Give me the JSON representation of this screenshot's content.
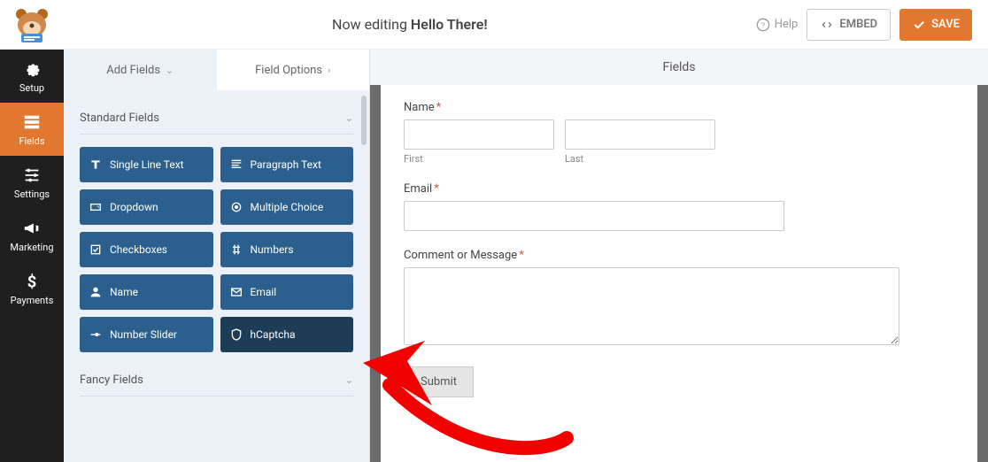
{
  "topbar": {
    "editing_prefix": "Now editing ",
    "title": "Hello There!",
    "help": "Help",
    "embed": "EMBED",
    "save": "SAVE"
  },
  "sidebar": {
    "items": [
      {
        "label": "Setup",
        "icon": "gear"
      },
      {
        "label": "Fields",
        "icon": "form"
      },
      {
        "label": "Settings",
        "icon": "sliders"
      },
      {
        "label": "Marketing",
        "icon": "bullhorn"
      },
      {
        "label": "Payments",
        "icon": "dollar"
      }
    ]
  },
  "panel": {
    "tabs": {
      "add": "Add Fields",
      "options": "Field Options"
    },
    "standard_title": "Standard Fields",
    "fancy_title": "Fancy Fields",
    "fields": [
      {
        "label": "Single Line Text"
      },
      {
        "label": "Paragraph Text"
      },
      {
        "label": "Dropdown"
      },
      {
        "label": "Multiple Choice"
      },
      {
        "label": "Checkboxes"
      },
      {
        "label": "Numbers"
      },
      {
        "label": "Name"
      },
      {
        "label": "Email"
      },
      {
        "label": "Number Slider"
      },
      {
        "label": "hCaptcha"
      }
    ]
  },
  "canvas": {
    "header": "Fields",
    "name_label": "Name",
    "first": "First",
    "last": "Last",
    "email_label": "Email",
    "comment_label": "Comment or Message",
    "submit": "Submit"
  }
}
